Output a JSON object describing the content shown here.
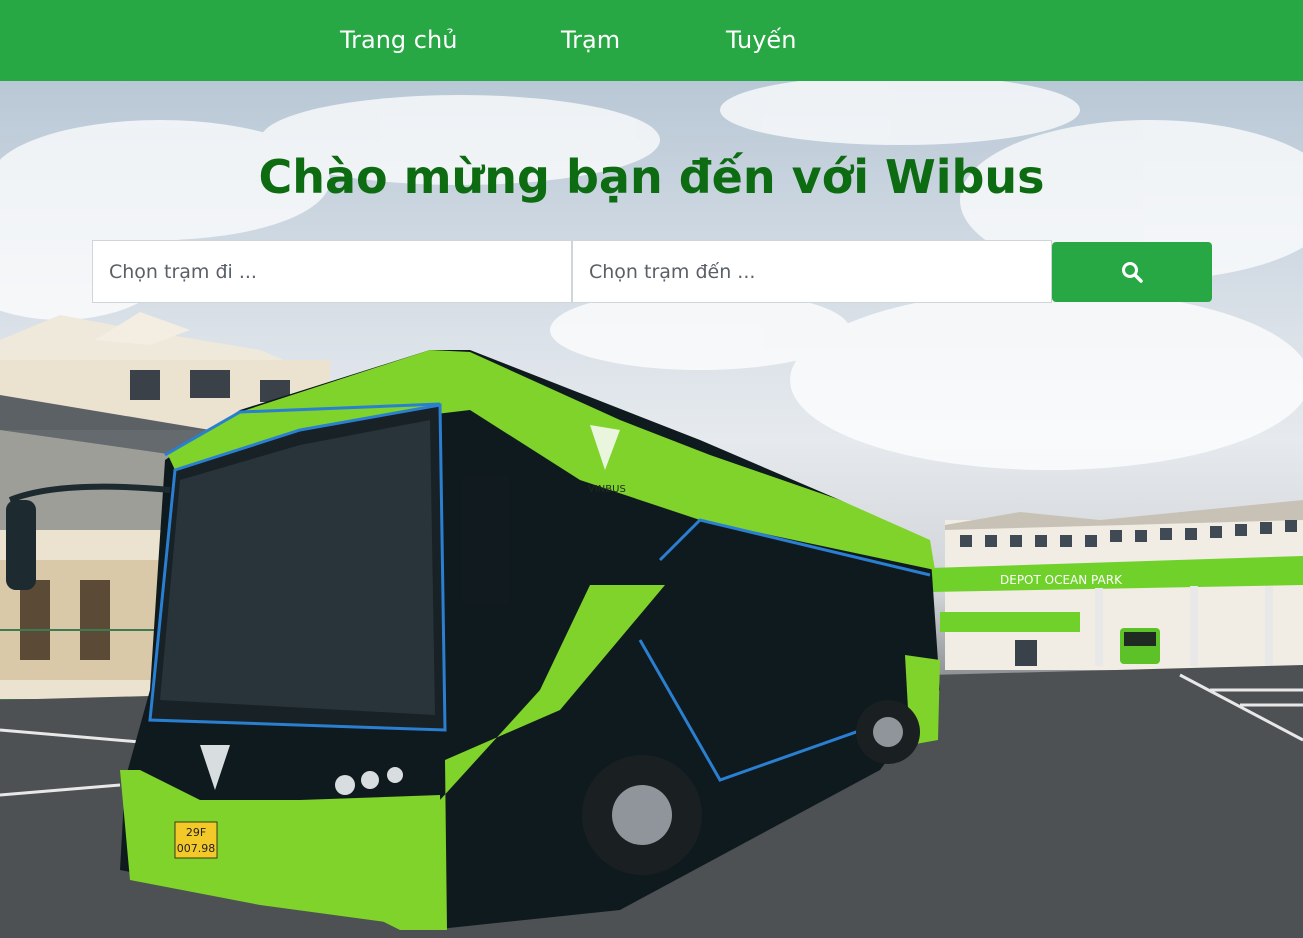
{
  "nav": {
    "home_label": "Trang chủ",
    "station_label": "Trạm",
    "route_label": "Tuyến"
  },
  "hero": {
    "title": "Chào mừng bạn đến với Wibus",
    "background_image": "green electric VinBus at depot"
  },
  "search": {
    "from_placeholder": "Chọn trạm đi ...",
    "to_placeholder": "Chọn trạm đến ...",
    "button_icon": "search-icon"
  },
  "scene": {
    "depot_sign": "DEPOT OCEAN PARK",
    "bus_logo": "VINBUS",
    "plate_line1": "29F",
    "plate_line2": "007.98"
  },
  "colors": {
    "navbar": "#28a745",
    "title": "#0d6b12",
    "button": "#28a745",
    "bus": "#7fd32a"
  }
}
